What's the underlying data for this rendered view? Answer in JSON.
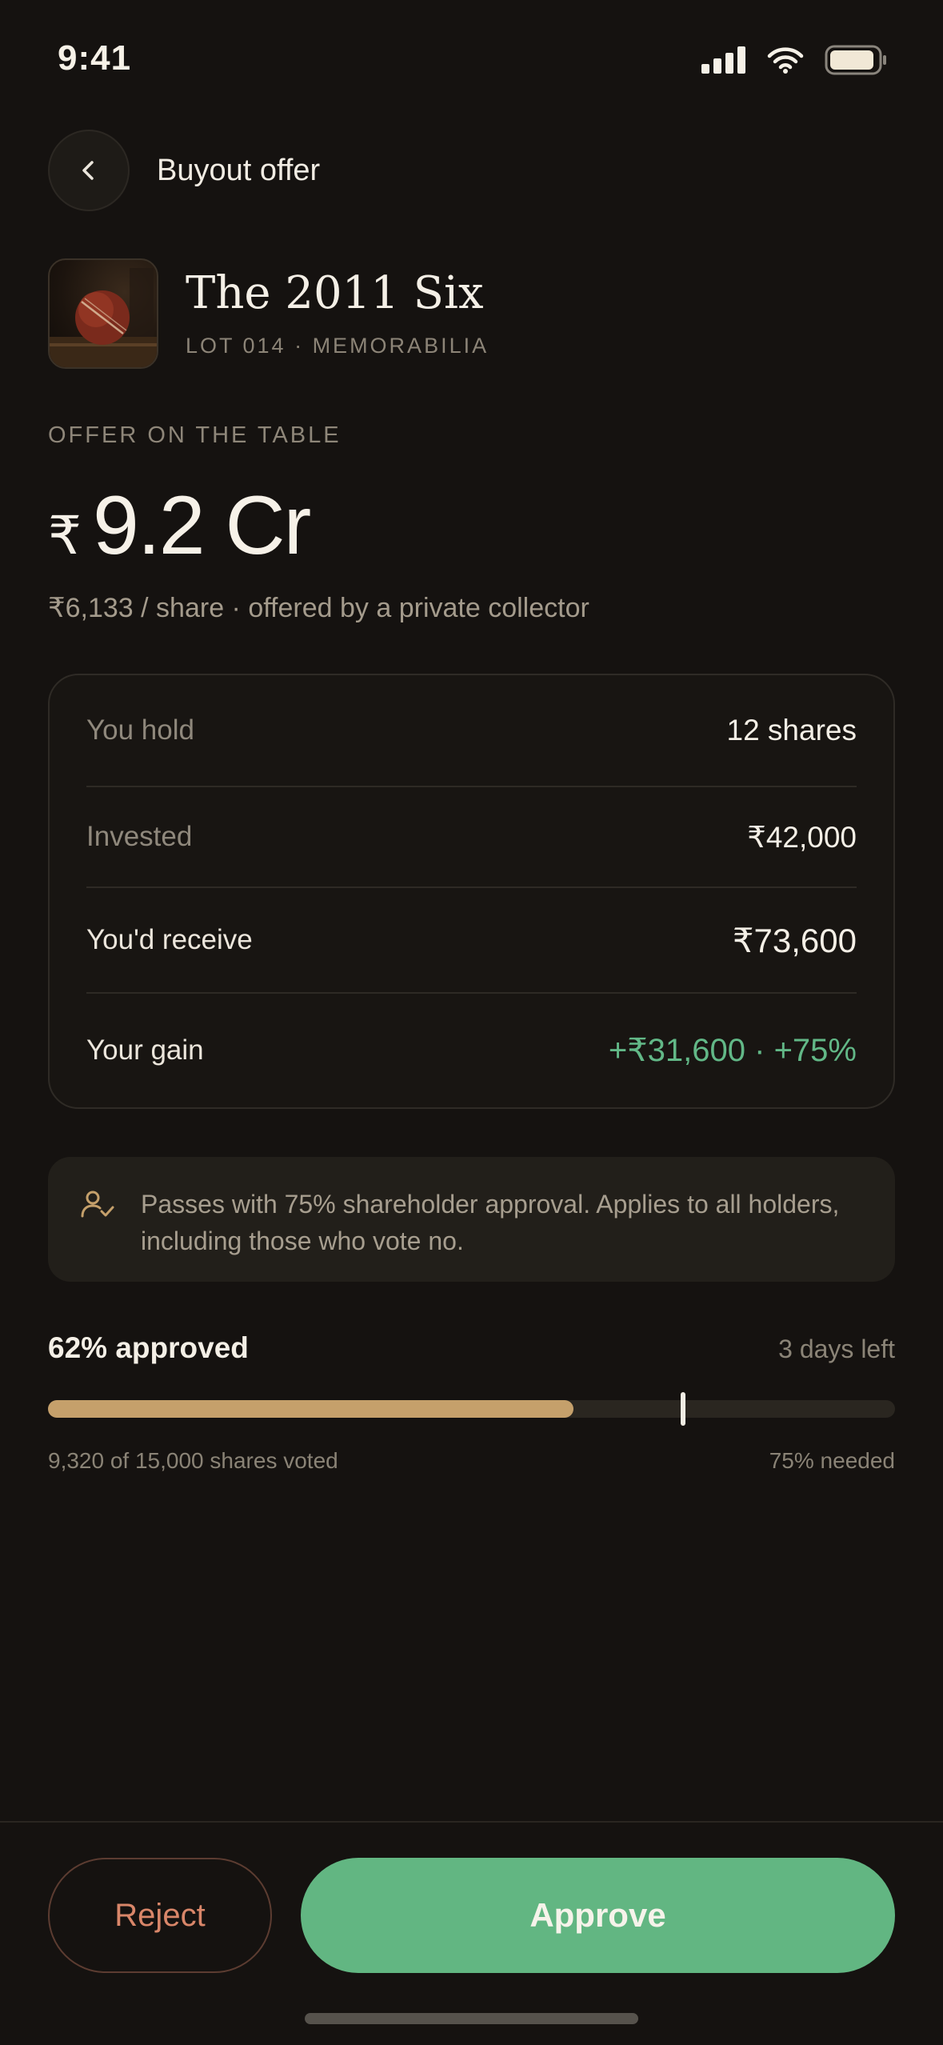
{
  "status_bar": {
    "time": "9:41"
  },
  "header": {
    "title": "Buyout offer"
  },
  "asset": {
    "title": "The 2011 Six",
    "subtitle": "LOT 014 · MEMORABILIA"
  },
  "offer": {
    "label": "OFFER ON THE TABLE",
    "currency": "₹",
    "amount": "9.2 Cr",
    "detail": "₹6,133 / share · offered by a private collector"
  },
  "holding": {
    "rows": [
      {
        "label": "You hold",
        "value": "12 shares"
      },
      {
        "label": "Invested",
        "value": "₹42,000"
      },
      {
        "label": "You'd receive",
        "value": "₹73,600"
      },
      {
        "label": "Your gain",
        "value": "+₹31,600 · +75%"
      }
    ]
  },
  "info": {
    "text": "Passes with 75% shareholder approval. Applies to all holders, including those who vote no."
  },
  "vote": {
    "approved_label": "62% approved",
    "time_left": "3 days left",
    "approved_fraction": 0.62,
    "threshold_fraction": 0.75,
    "shares_voted": "9,320 of 15,000 shares voted",
    "needed": "75% needed"
  },
  "actions": {
    "reject": "Reject",
    "approve": "Approve"
  },
  "colors": {
    "accent_green": "#62b682",
    "gold": "#c5a06b",
    "reject": "#d98669",
    "background": "#151210"
  },
  "icons": {
    "back": "chevron-left-icon",
    "info": "user-check-icon"
  }
}
